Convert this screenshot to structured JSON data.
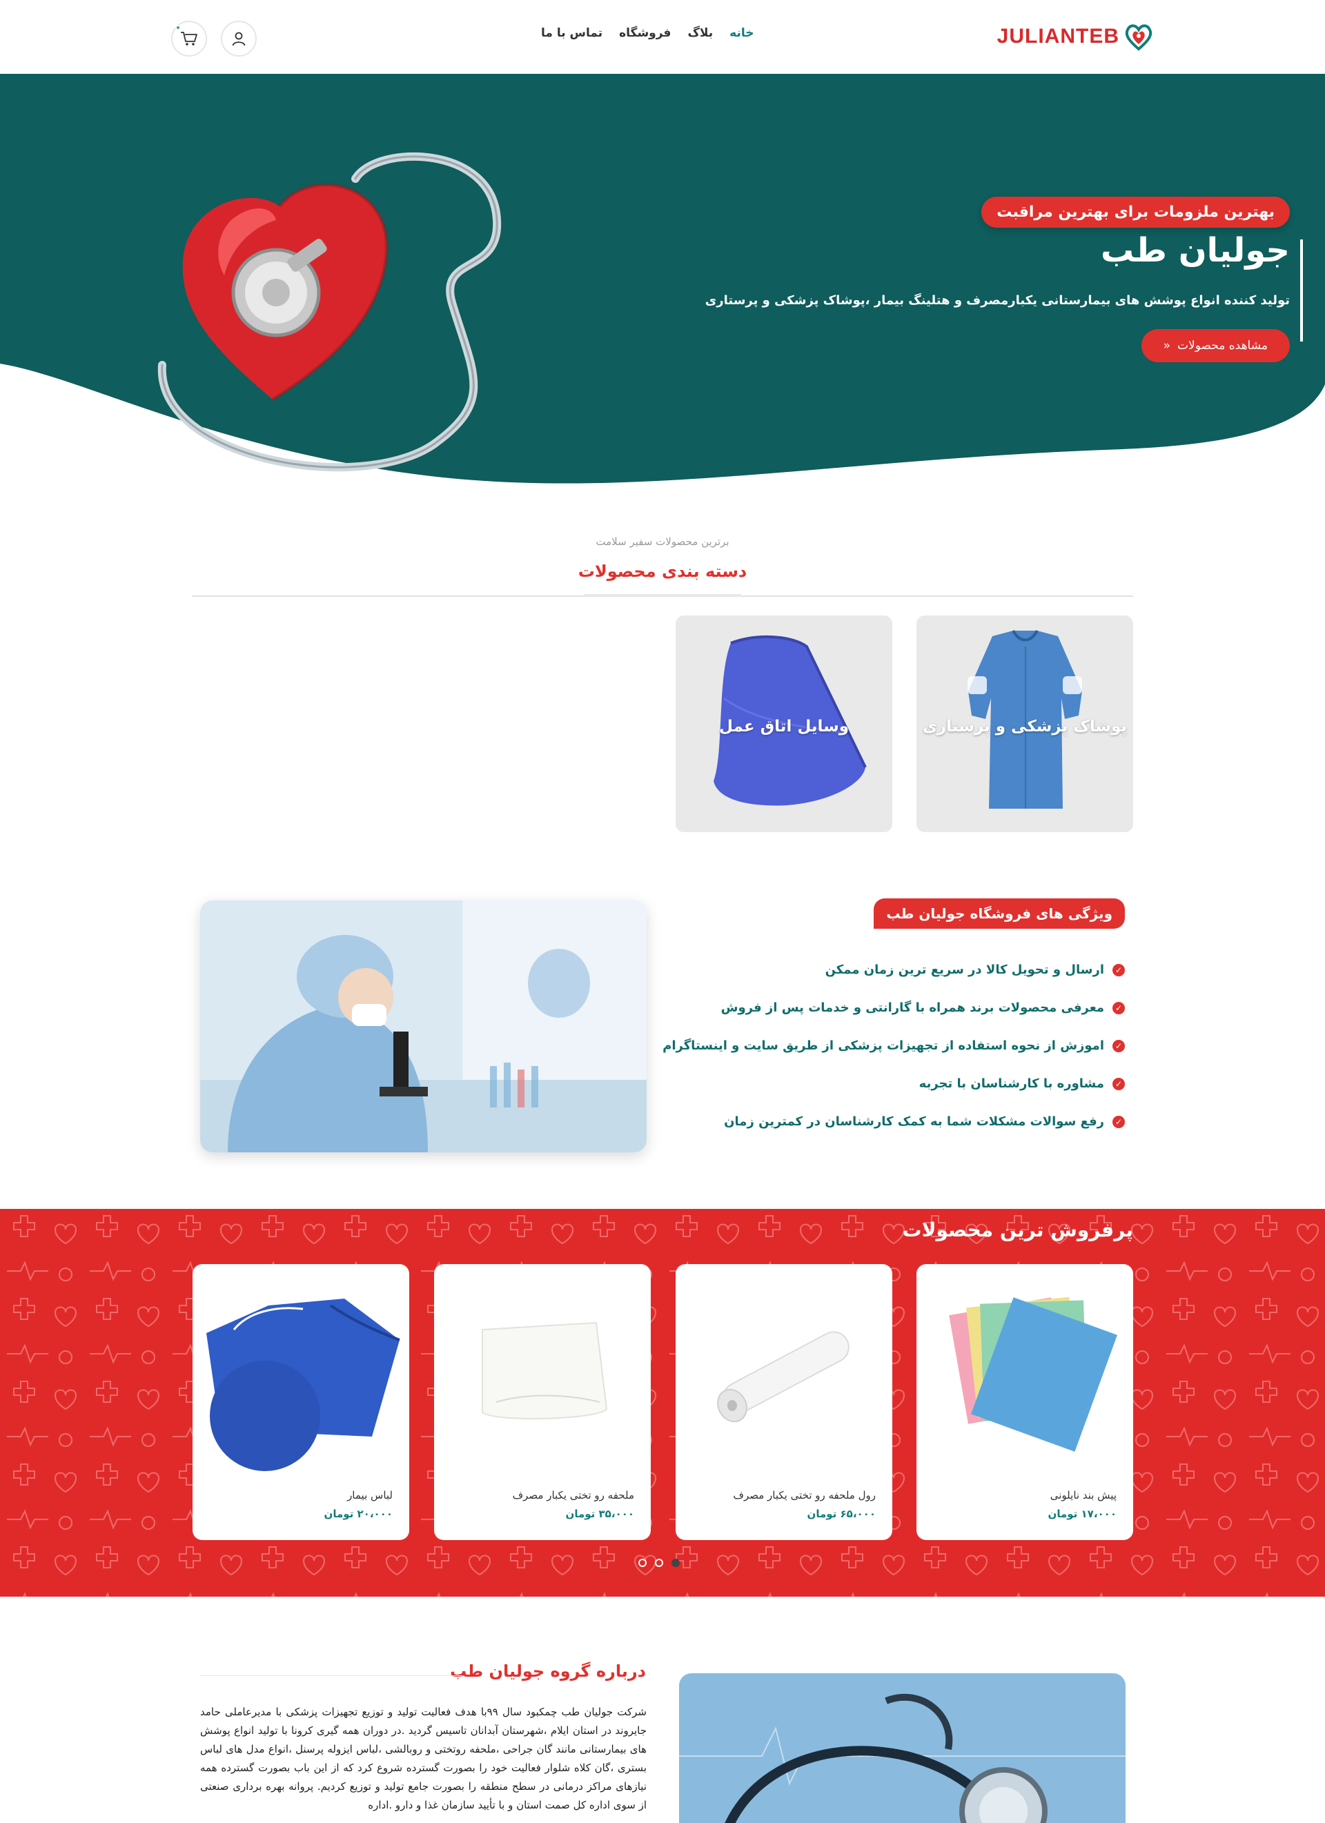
{
  "header": {
    "logo_text": "JULIANTEB",
    "nav": [
      {
        "label": "خانه",
        "active": true
      },
      {
        "label": "بلاگ",
        "active": false
      },
      {
        "label": "فروشگاه",
        "active": false
      },
      {
        "label": "تماس با ما",
        "active": false
      }
    ],
    "icons": [
      "user-icon",
      "cart-icon"
    ]
  },
  "hero": {
    "badge": "بهترین ملزومات برای بهترین مراقبت",
    "title": "جولیان طب",
    "subtitle": "تولید کننده انواع پوشش های بیمارستانی یکبارمصرف و هتلینگ بیمار ،پوشاک پزشکی و پرستاری",
    "cta": "مشاهده محصولات",
    "cta_icon": "double-chevron-left-icon"
  },
  "categories": {
    "kicker": "برترین محصولات سفیر سلامت",
    "title": "دسته بندی محصولات",
    "items": [
      {
        "label": "پوشاک پزشکی و پرستاری"
      },
      {
        "label": "وسایل اتاق عمل"
      }
    ]
  },
  "features": {
    "title": "ویژگی های فروشگاه جولیان طب",
    "items": [
      "ارسال و تحویل کالا در سریع ترین زمان ممکن",
      "معرفی محصولات برند همراه با گارانتی و خدمات پس از فروش",
      "اموزش از نحوه استفاده از تجهیزات پزشکی از طریق سایت و اینستاگرام",
      "مشاوره با کارشناسان با تجربه",
      "رفع سوالات مشکلات شما به کمک کارشناسان در کمترین زمان"
    ]
  },
  "bestsellers": {
    "title": "پرفروش ترین محصولات",
    "products": [
      {
        "name": "پیش بند نایلونی",
        "price": "۱۷،۰۰۰ تومان"
      },
      {
        "name": "رول ملحفه رو تختی یکبار مصرف",
        "price": "۶۵،۰۰۰ تومان"
      },
      {
        "name": "ملحفه رو تختی یکبار مصرف",
        "price": "۳۵،۰۰۰ تومان"
      },
      {
        "name": "لباس بیمار",
        "price": "۲۰،۰۰۰ تومان"
      }
    ],
    "dots": 3,
    "active_dot": 0
  },
  "about": {
    "title": "درباره گروه جولیان طب",
    "text": "شرکت جولیان طب چمکبود سال ۹۹با هدف فعالیت تولید و توزیع تجهیزات پزشکی با مدیرعاملی حامد جایروند در استان ایلام ،شهرستان آبدانان تاسیس گردید .در دوران همه گیری کرونا با تولید انواع پوشش های بیمارستانی مانند گان جراحی ،ملحفه روتختی و روبالشی ،لباس ایزوله پرسنل ،انواع مدل های لباس بستری ،گان کلاه شلوار فعالیت خود را بصورت گسترده شروع کرد که از این باب بصورت گسترده همه نیازهای مراکز درمانی در سطح منطقه را بصورت جامع تولید و توزیع کردیم. پروانه بهره برداری صنعتی از سوی اداره کل صمت استان و با تأیید سازمان غذا و دارو .اداره"
  },
  "colors": {
    "brand_red": "#e0312e",
    "brand_teal": "#0f5d5c",
    "accent_teal": "#0f7d7a"
  }
}
